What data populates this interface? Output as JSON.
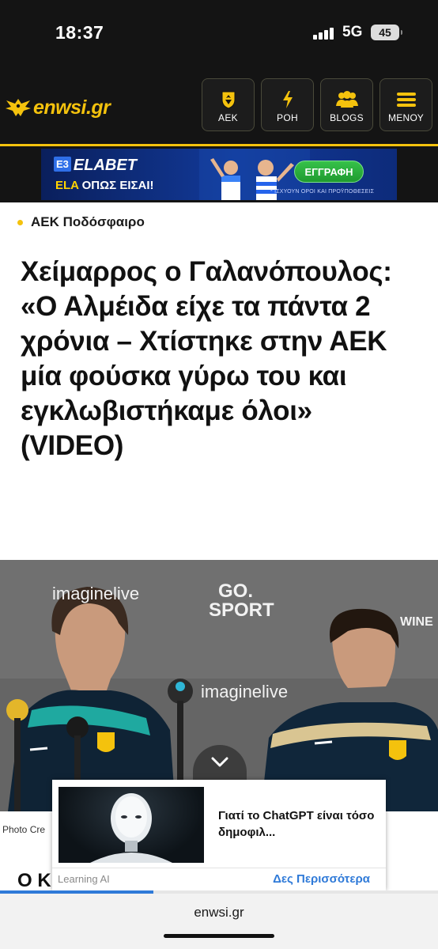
{
  "status_bar": {
    "time": "18:37",
    "network": "5G",
    "battery": "45"
  },
  "header": {
    "logo_text": "enwsi.gr",
    "nav": [
      {
        "label": "ΑΕΚ",
        "icon": "aek-crest-icon"
      },
      {
        "label": "ΡΟΗ",
        "icon": "lightning-icon"
      },
      {
        "label": "BLOGS",
        "icon": "users-icon"
      },
      {
        "label": "ΜΕΝΟΥ",
        "icon": "hamburger-menu-icon"
      }
    ],
    "accent_color": "#f4c20d"
  },
  "banner_ad": {
    "brand": "ELABET",
    "brand_badge": "E3",
    "slogan_highlight": "ELA",
    "slogan_rest": " ΟΠΩΣ ΕΙΣΑΙ!",
    "cta": "ΕΓΓΡΑΦΗ",
    "fine_print": "* ΙΣΧΥΟΥΝ ΟΡΟΙ ΚΑΙ ΠΡΟΫΠΟΘΕΣΕΙΣ"
  },
  "article": {
    "category": "ΑΕΚ Ποδόσφαιρο",
    "headline": "Χείμαρρος ο Γαλανόπουλος: «Ο Αλμέιδα είχε τα πάντα 2 χρόνια – Χτίστηκε στην ΑΕΚ μία φούσκα γύρω του και εγκλωβιστήκαμε όλοι» (VIDEO)",
    "photo_watermarks": [
      "GO.",
      "SPORT",
      "imaginelive",
      "WINE"
    ],
    "photo_caption": "Photo Cre",
    "subheading": "Ο Κ"
  },
  "floating_ad": {
    "title": "Γιατί το ChatGPT είναι τόσο δημοφιλ...",
    "source": "Learning AI",
    "more_label": "Δες Περισσότερα"
  },
  "page_progress": 0.35,
  "browser": {
    "url": "enwsi.gr"
  }
}
